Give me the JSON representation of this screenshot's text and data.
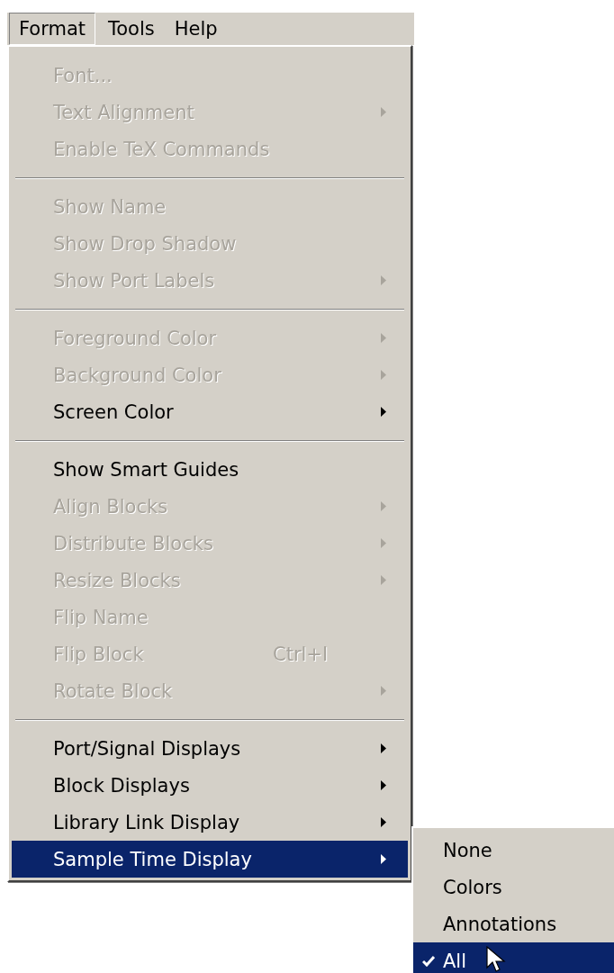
{
  "menubar": [
    {
      "label": "Format",
      "selected": true
    },
    {
      "label": "Tools",
      "selected": false
    },
    {
      "label": "Help",
      "selected": false
    }
  ],
  "menu": {
    "groups": [
      {
        "items": [
          {
            "label": "Font...",
            "disabled": true,
            "submenu": false
          },
          {
            "label": "Text Alignment",
            "disabled": true,
            "submenu": true
          },
          {
            "label": "Enable TeX Commands",
            "disabled": true,
            "submenu": false
          }
        ]
      },
      {
        "items": [
          {
            "label": "Show Name",
            "disabled": true,
            "submenu": false
          },
          {
            "label": "Show Drop Shadow",
            "disabled": true,
            "submenu": false
          },
          {
            "label": "Show Port Labels",
            "disabled": true,
            "submenu": true
          }
        ]
      },
      {
        "items": [
          {
            "label": "Foreground Color",
            "disabled": true,
            "submenu": true
          },
          {
            "label": "Background Color",
            "disabled": true,
            "submenu": true
          },
          {
            "label": "Screen Color",
            "disabled": false,
            "submenu": true
          }
        ]
      },
      {
        "items": [
          {
            "label": "Show Smart Guides",
            "disabled": false,
            "submenu": false
          },
          {
            "label": "Align Blocks",
            "disabled": true,
            "submenu": true
          },
          {
            "label": "Distribute Blocks",
            "disabled": true,
            "submenu": true
          },
          {
            "label": "Resize Blocks",
            "disabled": true,
            "submenu": true
          },
          {
            "label": "Flip Name",
            "disabled": true,
            "submenu": false
          },
          {
            "label": "Flip Block",
            "disabled": true,
            "submenu": false,
            "shortcut": "Ctrl+I"
          },
          {
            "label": "Rotate Block",
            "disabled": true,
            "submenu": true
          }
        ]
      },
      {
        "items": [
          {
            "label": "Port/Signal Displays",
            "disabled": false,
            "submenu": true
          },
          {
            "label": "Block Displays",
            "disabled": false,
            "submenu": true
          },
          {
            "label": "Library Link Display",
            "disabled": false,
            "submenu": true
          },
          {
            "label": "Sample Time Display",
            "disabled": false,
            "submenu": true,
            "selected": true
          }
        ]
      }
    ]
  },
  "submenu": {
    "items": [
      {
        "label": "None",
        "checked": false,
        "selected": false
      },
      {
        "label": "Colors",
        "checked": false,
        "selected": false
      },
      {
        "label": "Annotations",
        "checked": false,
        "selected": false
      },
      {
        "label": "All",
        "checked": true,
        "selected": true
      }
    ]
  }
}
